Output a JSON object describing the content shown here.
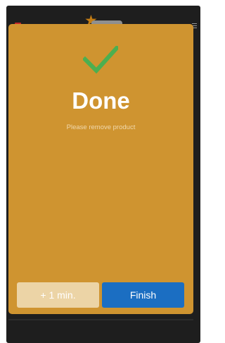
{
  "topbar": {
    "close_glyph": "×",
    "star_glyph": "★"
  },
  "dialog": {
    "icon": "checkmark-icon",
    "title": "Done",
    "subtitle": "Please remove product"
  },
  "buttons": {
    "add_time_label": "+ 1 min.",
    "finish_label": "Finish"
  },
  "colors": {
    "dialog_background": "#cf9430",
    "check": "#4caf50",
    "finish_button": "#1b6ec2",
    "add_time_button": "#ecd4a6"
  }
}
